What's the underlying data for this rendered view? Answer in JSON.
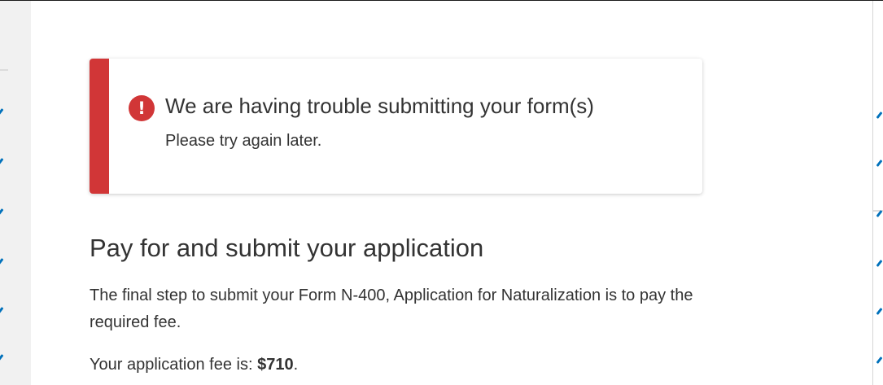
{
  "alert": {
    "icon": "exclamation-icon",
    "icon_glyph": "!",
    "title": "We are having trouble submitting your form(s)",
    "message": "Please try again later.",
    "accent_color": "#d13637"
  },
  "section": {
    "heading": "Pay for and submit your application",
    "intro": "The final step to submit your Form N-400, Application for Naturalization is to pay the required fee.",
    "fee_label": "Your application fee is: ",
    "fee_amount": "$710",
    "fee_suffix": "."
  },
  "colors": {
    "text": "#333333",
    "rail": "#f1f1f1",
    "link_accent": "#0071bb"
  }
}
